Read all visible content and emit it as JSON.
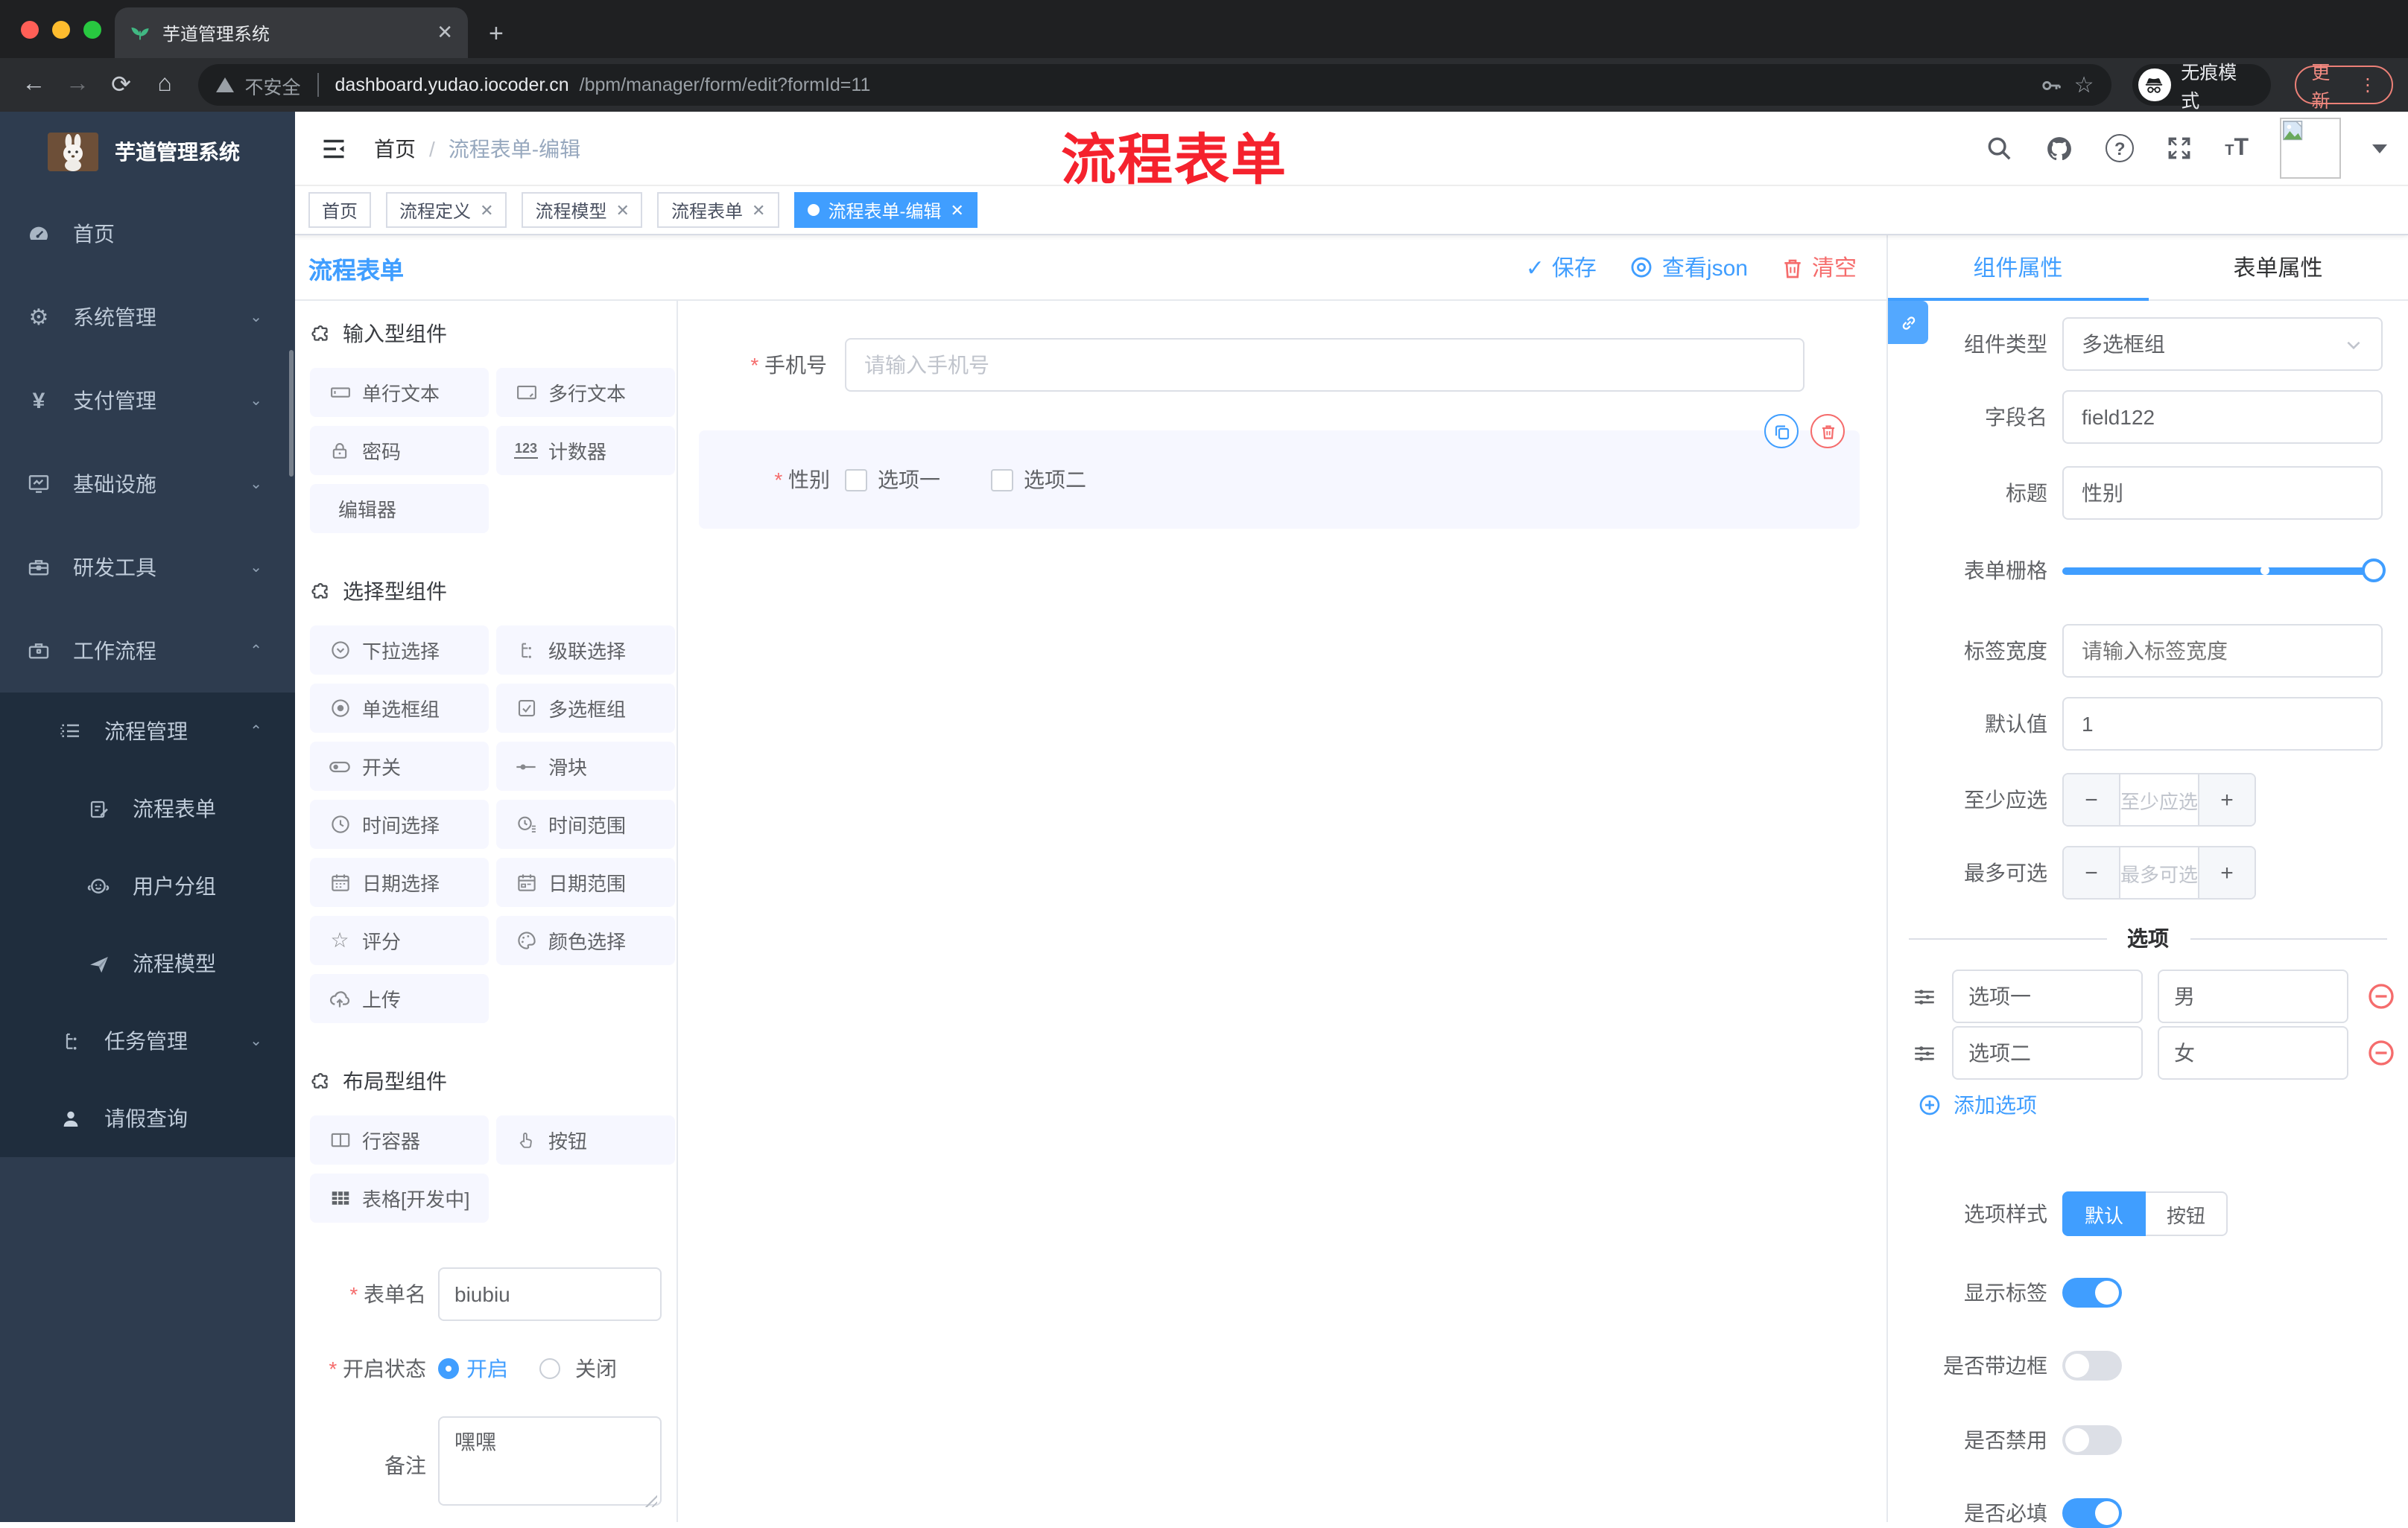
{
  "browser": {
    "tab_title": "芋道管理系统",
    "security_label": "不安全",
    "url_host": "dashboard.yudao.iocoder.cn",
    "url_path": "/bpm/manager/form/edit?formId=11",
    "incognito_label": "无痕模式",
    "update_label": "更新"
  },
  "sidebar": {
    "title": "芋道管理系统",
    "items": [
      {
        "label": "首页"
      },
      {
        "label": "系统管理"
      },
      {
        "label": "支付管理"
      },
      {
        "label": "基础设施"
      },
      {
        "label": "研发工具"
      },
      {
        "label": "工作流程"
      },
      {
        "label": "流程管理"
      },
      {
        "label": "流程表单"
      },
      {
        "label": "用户分组"
      },
      {
        "label": "流程模型"
      },
      {
        "label": "任务管理"
      },
      {
        "label": "请假查询"
      }
    ]
  },
  "header": {
    "breadcrumb_home": "首页",
    "breadcrumb_current": "流程表单-编辑",
    "annotation": "流程表单"
  },
  "tags": [
    {
      "label": "首页"
    },
    {
      "label": "流程定义"
    },
    {
      "label": "流程模型"
    },
    {
      "label": "流程表单"
    },
    {
      "label": "流程表单-编辑"
    }
  ],
  "toolbar": {
    "title": "流程表单",
    "save": "保存",
    "view_json": "查看json",
    "clear": "清空"
  },
  "components": {
    "sections": [
      {
        "title": "输入型组件",
        "items": [
          {
            "label": "单行文本"
          },
          {
            "label": "多行文本"
          },
          {
            "label": "密码"
          },
          {
            "label": "计数器"
          },
          {
            "label": "编辑器"
          }
        ]
      },
      {
        "title": "选择型组件",
        "items": [
          {
            "label": "下拉选择"
          },
          {
            "label": "级联选择"
          },
          {
            "label": "单选框组"
          },
          {
            "label": "多选框组"
          },
          {
            "label": "开关"
          },
          {
            "label": "滑块"
          },
          {
            "label": "时间选择"
          },
          {
            "label": "时间范围"
          },
          {
            "label": "日期选择"
          },
          {
            "label": "日期范围"
          },
          {
            "label": "评分"
          },
          {
            "label": "颜色选择"
          },
          {
            "label": "上传"
          }
        ]
      },
      {
        "title": "布局型组件",
        "items": [
          {
            "label": "行容器"
          },
          {
            "label": "按钮"
          },
          {
            "label": "表格[开发中]"
          }
        ]
      }
    ]
  },
  "form_meta": {
    "name_label": "表单名",
    "name_value": "biubiu",
    "status_label": "开启状态",
    "status_on": "开启",
    "status_off": "关闭",
    "remark_label": "备注",
    "remark_value": "嘿嘿"
  },
  "canvas": {
    "phone_label": "手机号",
    "phone_placeholder": "请输入手机号",
    "gender_label": "性别",
    "gender_option1": "选项一",
    "gender_option2": "选项二"
  },
  "props": {
    "tab_component": "组件属性",
    "tab_form": "表单属性",
    "type_label": "组件类型",
    "type_value": "多选框组",
    "field_label": "字段名",
    "field_value": "field122",
    "title_label": "标题",
    "title_value": "性别",
    "grid_label": "表单栅格",
    "width_label": "标签宽度",
    "width_placeholder": "请输入标签宽度",
    "default_label": "默认值",
    "default_value": "1",
    "min_label": "至少应选",
    "min_placeholder": "至少应选",
    "max_label": "最多可选",
    "max_placeholder": "最多可选",
    "options_title": "选项",
    "options": [
      {
        "label": "选项一",
        "value": "男"
      },
      {
        "label": "选项二",
        "value": "女"
      }
    ],
    "add_option": "添加选项",
    "style_label": "选项样式",
    "style_default": "默认",
    "style_button": "按钮",
    "show_label_label": "显示标签",
    "border_label": "是否带边框",
    "disabled_label": "是否禁用",
    "required_label": "是否必填"
  },
  "colors": {
    "primary": "#409EFF",
    "danger": "#F56C6C",
    "annotation_red": "#F5222D"
  }
}
